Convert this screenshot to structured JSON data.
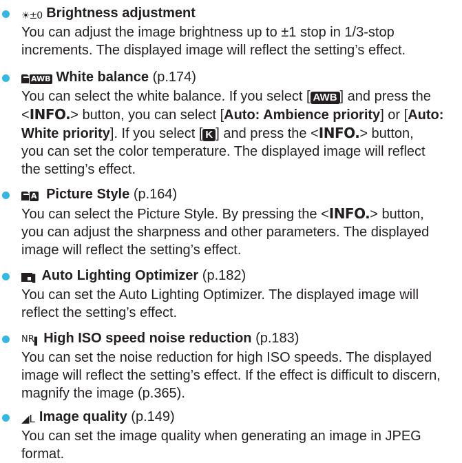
{
  "items": [
    {
      "icon": "brightness-icon",
      "icon_text": "☀±0",
      "title": "Brightness adjustment",
      "ref": "",
      "lines": [
        "You can adjust the image brightness up to ±1 stop in 1/3-stop",
        "increments. The displayed image will reflect the setting’s effect."
      ]
    },
    {
      "icon": "white-balance-icon",
      "icon_text": "AWB",
      "title": "White balance",
      "ref": "(p.174)",
      "line1": "You can select the white balance. If you select [",
      "awb_chip": "AWB",
      "line1_end": "] and press the",
      "line2_pre": "<",
      "info": "INFO.",
      "line2_mid": "> button, you can select [",
      "auto_ambience": "Auto: Ambience priority",
      "line2_or": "] or [",
      "auto_word": "Auto:",
      "line3_bold": "White priority",
      "line3_mid": "]. If you select [",
      "k_chip": "K",
      "line3_end1": "] and press the <",
      "line3_end2": "> button,",
      "line4": "you can set the color temperature. The displayed image will reflect",
      "line5": "the setting’s effect."
    },
    {
      "icon": "picture-style-icon",
      "icon_text": "A",
      "title": "Picture Style",
      "ref": "(p.164)",
      "line1": "You can select the Picture Style. By pressing the <",
      "info": "INFO.",
      "line1_end": "> button,",
      "line2": "you can adjust the sharpness and other parameters. The displayed",
      "line3": "image will reflect the setting’s effect."
    },
    {
      "icon": "auto-lighting-optimizer-icon",
      "icon_text": "",
      "title": "Auto Lighting Optimizer",
      "ref": "(p.182)",
      "lines": [
        "You can set the Auto Lighting Optimizer. The displayed image will",
        "reflect the setting’s effect."
      ]
    },
    {
      "icon": "noise-reduction-icon",
      "icon_text": "NR",
      "title": "High ISO speed noise reduction",
      "ref": "(p.183)",
      "lines": [
        "You can set the noise reduction for high ISO speeds. The displayed",
        "image will reflect the setting’s effect. If the effect is difficult to discern,",
        "magnify the image (p.365)."
      ]
    },
    {
      "icon": "image-quality-icon",
      "icon_text": "◢L",
      "title": "Image quality",
      "ref": "(p.149)",
      "lines": [
        "You can set the image quality when generating an image in JPEG",
        "format."
      ]
    }
  ],
  "colors": {
    "bullet": "#35b7e5",
    "text": "#231f20"
  }
}
